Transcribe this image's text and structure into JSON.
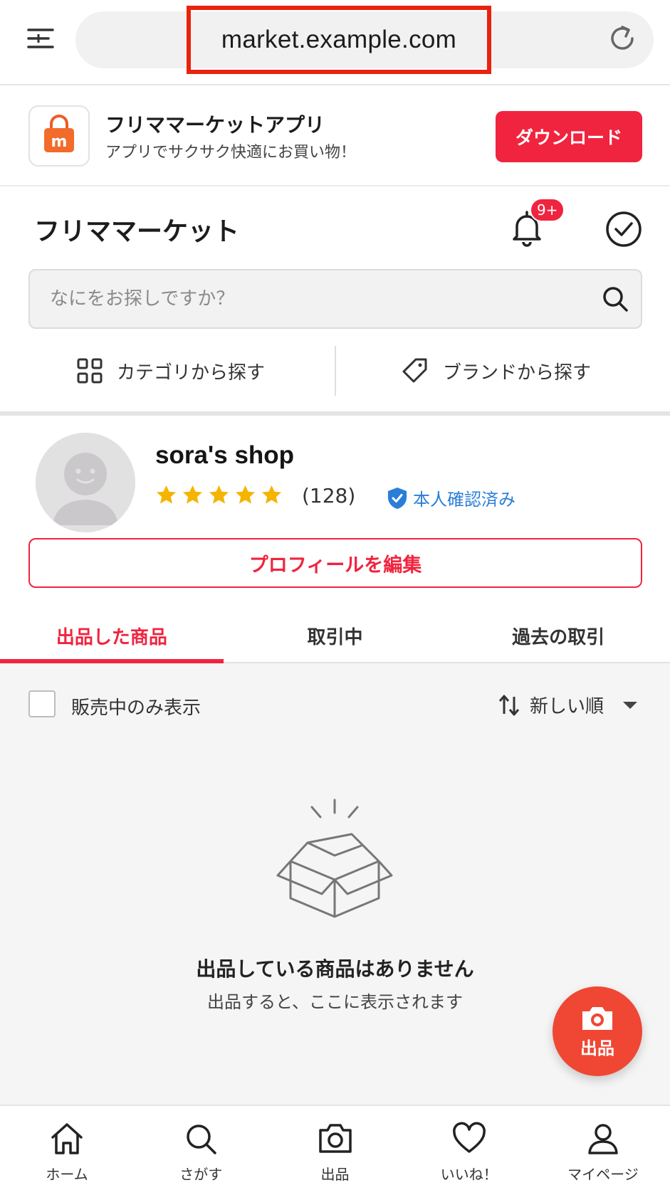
{
  "browser": {
    "url": "market.example.com"
  },
  "app_banner": {
    "title": "フリママーケットアプリ",
    "subtitle": "アプリでサクサク快適にお買い物！",
    "download_label": "ダウンロード",
    "icon_letter": "m"
  },
  "header": {
    "site_title": "フリママーケット",
    "notification_badge": "9+"
  },
  "search": {
    "placeholder": "なにをお探しですか？"
  },
  "browse": {
    "category_label": "カテゴリから探す",
    "brand_label": "ブランドから探す"
  },
  "profile": {
    "shop_name": "sora's shop",
    "rating_stars": 5,
    "review_count": "(128)",
    "verified_label": "本人確認済み",
    "edit_label": "プロフィールを編集"
  },
  "tabs": [
    {
      "label": "出品した商品",
      "active": true
    },
    {
      "label": "取引中",
      "active": false
    },
    {
      "label": "過去の取引",
      "active": false
    }
  ],
  "filter": {
    "on_sale_only_label": "販売中のみ表示",
    "sort_label": "新しい順"
  },
  "empty_state": {
    "title": "出品している商品はありません",
    "subtitle": "出品すると、ここに表示されます"
  },
  "fab": {
    "label": "出品"
  },
  "bottom_nav": [
    {
      "label": "ホーム",
      "icon": "home-icon"
    },
    {
      "label": "さがす",
      "icon": "search-icon"
    },
    {
      "label": "出品",
      "icon": "camera-icon"
    },
    {
      "label": "いいね！",
      "icon": "heart-icon"
    },
    {
      "label": "マイページ",
      "icon": "person-icon"
    }
  ],
  "colors": {
    "accent": "#f0243f",
    "fab": "#ef4733",
    "verified": "#2a7ed8",
    "star": "#f5b400"
  }
}
